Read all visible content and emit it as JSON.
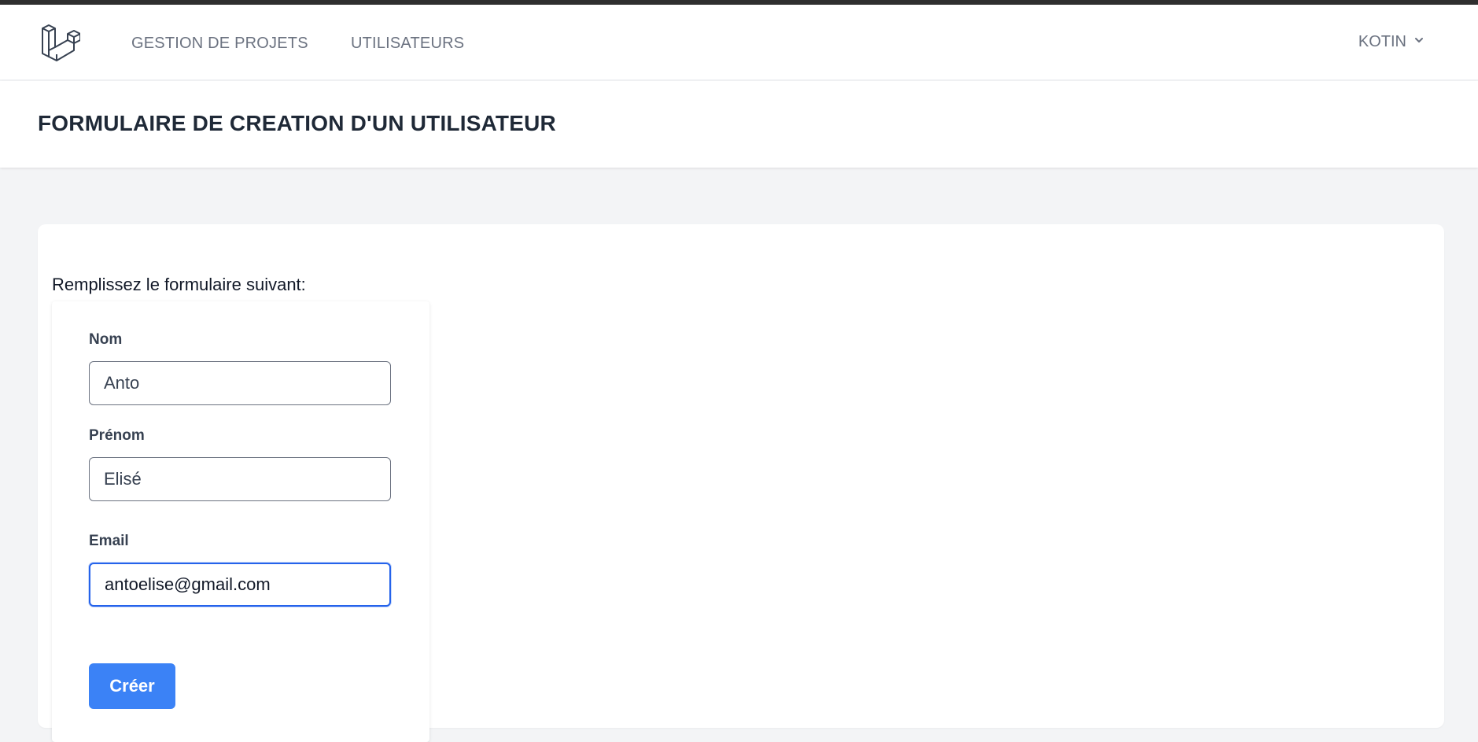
{
  "nav": {
    "links": [
      {
        "label": "GESTION DE PROJETS"
      },
      {
        "label": "UTILISATEURS"
      }
    ],
    "user": {
      "name": "KOTIN"
    }
  },
  "header": {
    "title": "FORMULAIRE DE CREATION D'UN UTILISATEUR"
  },
  "form": {
    "instructions": "Remplissez le formulaire suivant:",
    "fields": {
      "nom": {
        "label": "Nom",
        "value": "Anto"
      },
      "prenom": {
        "label": "Prénom",
        "value": "Elisé"
      },
      "email": {
        "label": "Email",
        "value": "antoelise@gmail.com"
      }
    },
    "submit_label": "Créer"
  },
  "colors": {
    "accent": "#3b82f6",
    "focus_border": "#2563eb"
  }
}
